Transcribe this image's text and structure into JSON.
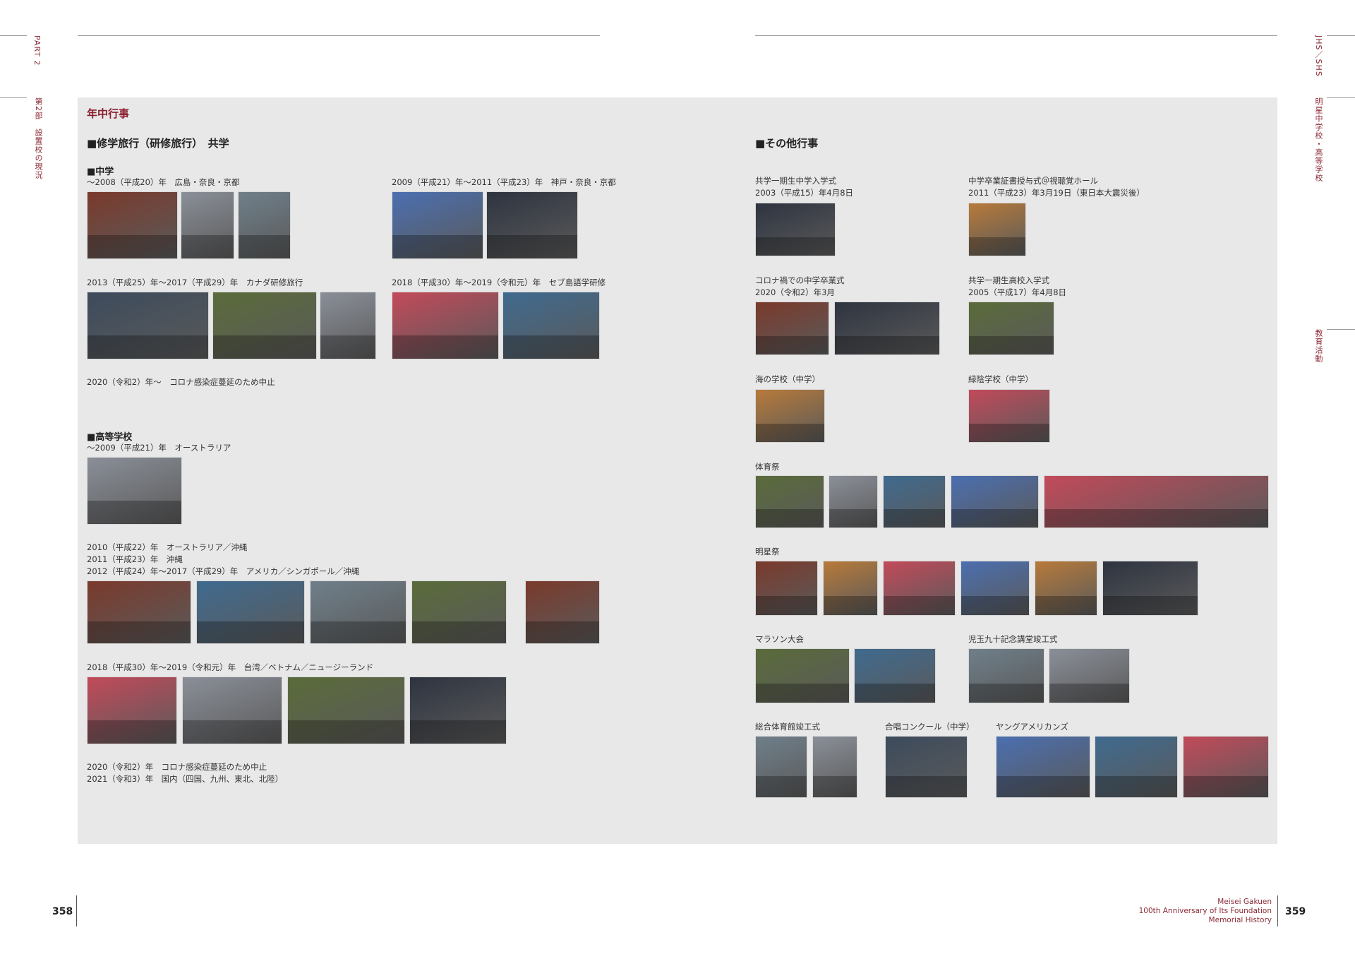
{
  "left_page": {
    "part_label": "PART 2",
    "chapter_label": "第2部　設置校の現況",
    "page_number": "358"
  },
  "right_page": {
    "series_label": "JHS／SHS",
    "school_label": "明星中学校・高等学校",
    "section_label": "教育活動",
    "page_number": "359",
    "footer": [
      "Meisei Gakuen",
      "100th Anniversary of Its Foundation",
      "Memorial History"
    ]
  },
  "panel_title": "年中行事",
  "trip": {
    "heading": "■修学旅行（研修旅行）　共学",
    "jhs_heading": "■中学",
    "jhs_cap_1": "～2008（平成20）年　広島・奈良・京都",
    "jhs_cap_2": "2009（平成21）年～2011（平成23）年　神戸・奈良・京都",
    "jhs_cap_3": "2013（平成25）年～2017（平成29）年　カナダ研修旅行",
    "jhs_cap_4": "2018（平成30）年～2019（令和元）年　セブ島語学研修",
    "jhs_note": "2020（令和2）年～　コロナ感染症蔓延のため中止",
    "shs_heading": "■高等学校",
    "shs_cap_1": "～2009（平成21）年　オーストラリア",
    "shs_cap_2": [
      "2010（平成22）年　オーストラリア／沖縄",
      "2011（平成23）年　沖縄",
      "2012（平成24）年～2017（平成29）年　アメリカ／シンガポール／沖縄"
    ],
    "shs_cap_3": "2018（平成30）年～2019（令和元）年　台湾／ベトナム／ニュージーランド",
    "shs_notes": [
      "2020（令和2）年　コロナ感染症蔓延のため中止",
      "2021（令和3）年　国内（四国、九州、東北、北陸）"
    ]
  },
  "other": {
    "heading": "■その他行事",
    "events": {
      "e1": [
        "共学一期生中学入学式",
        "2003（平成15）年4月8日"
      ],
      "e2": [
        "中学卒業証書授与式＠視聴覚ホール",
        "2011（平成23）年3月19日（東日本大震災後）"
      ],
      "e3": [
        "コロナ禍での中学卒業式",
        "2020（令和2）年3月"
      ],
      "e4": [
        "共学一期生高校入学式",
        "2005（平成17）年4月8日"
      ],
      "e5": "海の学校（中学）",
      "e6": "緑陰学校（中学）",
      "e7": "体育祭",
      "e8": "明星祭",
      "e9": "マラソン大会",
      "e10": "児玉九十記念講堂竣工式",
      "e11": "総合体育館竣工式",
      "e12": "合唱コンクール（中学）",
      "e13": "ヤングアメリカンズ"
    }
  },
  "photo_palette": [
    "#7a3a2c",
    "#6f7f8a",
    "#3d4b5c",
    "#c24a5a",
    "#3f6a8f",
    "#5a6b3a",
    "#2e3440",
    "#b77a3a",
    "#4b6fb0",
    "#8a8f98"
  ]
}
